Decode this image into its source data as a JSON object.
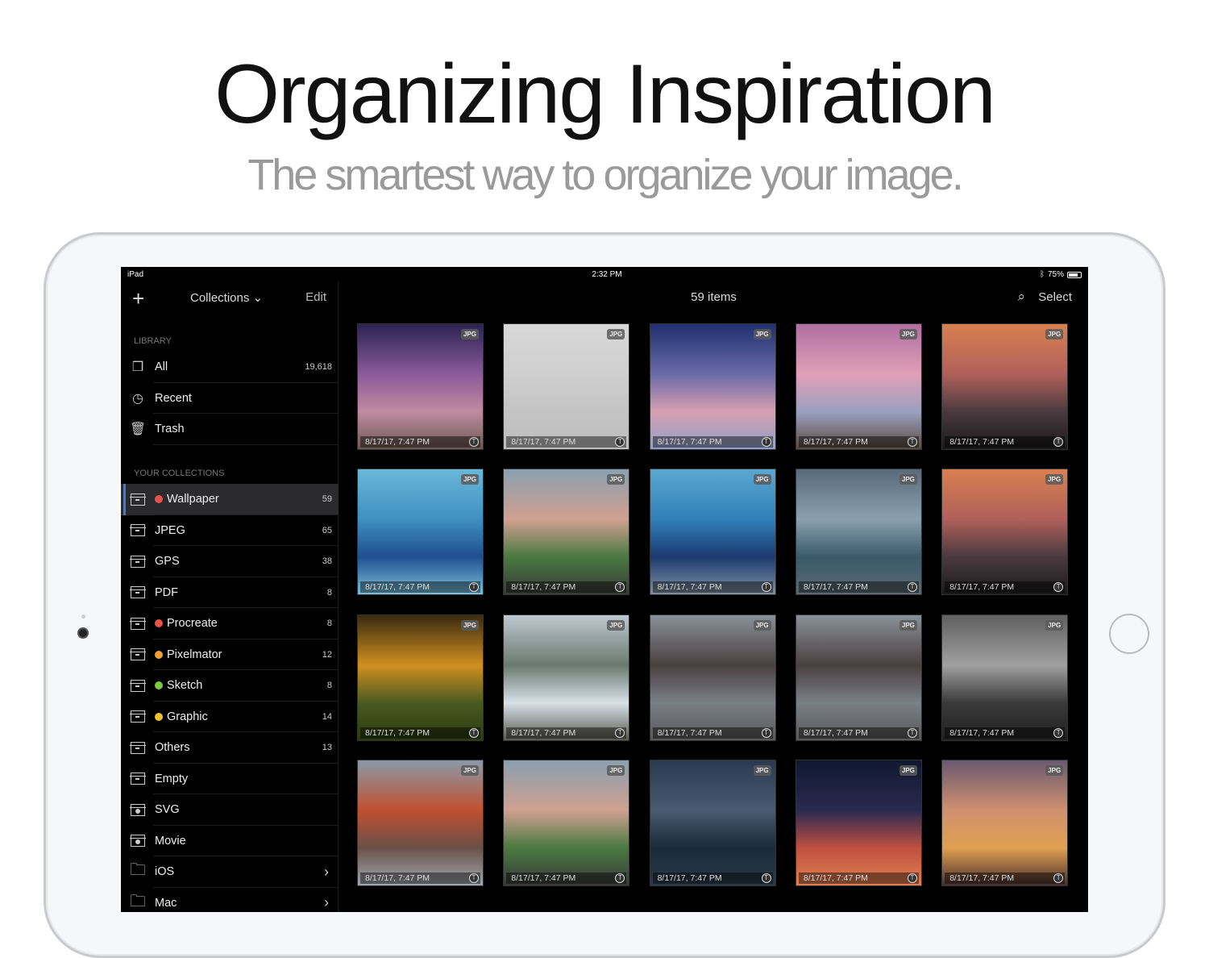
{
  "hero": {
    "title": "Organizing Inspiration",
    "subtitle": "The smartest way to organize your image."
  },
  "status": {
    "device": "iPad",
    "time": "2:32 PM",
    "battery": "75%"
  },
  "sidebar": {
    "nav": {
      "add": "+",
      "title": "Collections",
      "edit": "Edit"
    },
    "library_header": "LIBRARY",
    "library": [
      {
        "label": "All",
        "count": "19,618",
        "icon": "stack-icon"
      },
      {
        "label": "Recent",
        "count": "",
        "icon": "clock-icon"
      },
      {
        "label": "Trash",
        "count": "",
        "icon": "trash-icon"
      }
    ],
    "collections_header": "YOUR COLLECTIONS",
    "collections": [
      {
        "label": "Wallpaper",
        "count": "59",
        "dot": "#e5534b",
        "selected": true,
        "icon": "box"
      },
      {
        "label": "JPEG",
        "count": "65",
        "icon": "box"
      },
      {
        "label": "GPS",
        "count": "38",
        "icon": "box"
      },
      {
        "label": "PDF",
        "count": "8",
        "icon": "box"
      },
      {
        "label": "Procreate",
        "count": "8",
        "dot": "#e5534b",
        "icon": "box"
      },
      {
        "label": "Pixelmator",
        "count": "12",
        "dot": "#f0a030",
        "icon": "box"
      },
      {
        "label": "Sketch",
        "count": "8",
        "dot": "#7ac943",
        "icon": "box"
      },
      {
        "label": "Graphic",
        "count": "14",
        "dot": "#f2c12e",
        "icon": "box"
      },
      {
        "label": "Others",
        "count": "13",
        "icon": "box"
      },
      {
        "label": "Empty",
        "count": "",
        "icon": "box"
      },
      {
        "label": "SVG",
        "count": "",
        "icon": "smart"
      },
      {
        "label": "Movie",
        "count": "",
        "icon": "smart"
      },
      {
        "label": "iOS",
        "count": "",
        "icon": "folder",
        "chevron": true
      },
      {
        "label": "Mac",
        "count": "",
        "icon": "folder",
        "chevron": true
      }
    ]
  },
  "main": {
    "title": "59 items",
    "select": "Select"
  },
  "tiles": [
    {
      "badge": "JPG",
      "date": "8/17/17, 7:47 PM",
      "colors": [
        "#2a2352",
        "#8c5a9a",
        "#c08aa0",
        "#6b5a55"
      ]
    },
    {
      "badge": "JPG",
      "date": "8/17/17, 7:47 PM",
      "colors": [
        "#d8d8d8",
        "#cfcfcf",
        "#c4c4c4",
        "#bdbdbd"
      ]
    },
    {
      "badge": "JPG",
      "date": "8/17/17, 7:47 PM",
      "colors": [
        "#1f3070",
        "#6a6aa8",
        "#d7a0b0",
        "#8fa0c8"
      ]
    },
    {
      "badge": "JPG",
      "date": "8/17/17, 7:47 PM",
      "colors": [
        "#b06fa0",
        "#e0a0b8",
        "#9aa0c0",
        "#5a4a40"
      ]
    },
    {
      "badge": "JPG",
      "date": "8/17/17, 7:47 PM",
      "colors": [
        "#d88050",
        "#b0605a",
        "#4a3a40",
        "#1a1a1a"
      ]
    },
    {
      "badge": "JPG",
      "date": "8/17/17, 7:47 PM",
      "colors": [
        "#6ab8d8",
        "#3f8fc0",
        "#1f4f90",
        "#7ac0d8"
      ]
    },
    {
      "badge": "JPG",
      "date": "8/17/17, 7:47 PM",
      "colors": [
        "#8aa0b0",
        "#d0a090",
        "#4a7a40",
        "#3a3a3a"
      ]
    },
    {
      "badge": "JPG",
      "date": "8/17/17, 7:47 PM",
      "colors": [
        "#5aa8d0",
        "#3080b8",
        "#1a3a70",
        "#8090a0"
      ]
    },
    {
      "badge": "JPG",
      "date": "8/17/17, 7:47 PM",
      "colors": [
        "#5a6a7a",
        "#8aa0b0",
        "#3a5a6a",
        "#5a6a70"
      ]
    },
    {
      "badge": "JPG",
      "date": "8/17/17, 7:47 PM",
      "colors": [
        "#d88050",
        "#b0605a",
        "#4a3a40",
        "#1a1a1a"
      ]
    },
    {
      "badge": "JPG",
      "date": "8/17/17, 7:47 PM",
      "colors": [
        "#3a2a10",
        "#d09020",
        "#4a5a20",
        "#2a3a10"
      ]
    },
    {
      "badge": "JPG",
      "date": "8/17/17, 7:47 PM",
      "colors": [
        "#c0c8d0",
        "#6a7a70",
        "#d8e0e8",
        "#5a5a50"
      ]
    },
    {
      "badge": "JPG",
      "date": "8/17/17, 7:47 PM",
      "colors": [
        "#8a9098",
        "#4a4040",
        "#7a8088",
        "#5a5858"
      ]
    },
    {
      "badge": "JPG",
      "date": "8/17/17, 7:47 PM",
      "colors": [
        "#8a9098",
        "#4a4040",
        "#7a8088",
        "#5a5858"
      ]
    },
    {
      "badge": "JPG",
      "date": "8/17/17, 7:47 PM",
      "colors": [
        "#606060",
        "#a0a0a0",
        "#3a3a3a",
        "#202020"
      ]
    },
    {
      "badge": "JPG",
      "date": "8/17/17, 7:47 PM",
      "colors": [
        "#8a9aa8",
        "#c05030",
        "#6a5048",
        "#a0a8b0"
      ]
    },
    {
      "badge": "JPG",
      "date": "8/17/17, 7:47 PM",
      "colors": [
        "#8aa0b0",
        "#d0a090",
        "#4a7a40",
        "#3a3a3a"
      ]
    },
    {
      "badge": "JPG",
      "date": "8/17/17, 7:47 PM",
      "colors": [
        "#2a3a50",
        "#4a5a70",
        "#1a2a3a",
        "#2a3a48"
      ]
    },
    {
      "badge": "JPG",
      "date": "8/17/17, 7:47 PM",
      "colors": [
        "#101830",
        "#2a2a50",
        "#c05040",
        "#e08050"
      ]
    },
    {
      "badge": "JPG",
      "date": "8/17/17, 7:47 PM",
      "colors": [
        "#6a5a70",
        "#d09070",
        "#e0a050",
        "#4a3030"
      ]
    }
  ]
}
